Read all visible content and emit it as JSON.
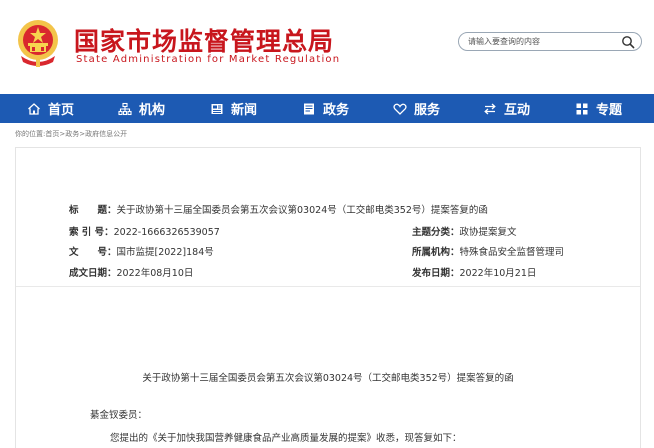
{
  "header": {
    "title_cn": "国家市场监督管理总局",
    "title_en": "State Administration for Market Regulation",
    "search_placeholder": "请输入要查询的内容",
    "colors": {
      "brand_red": "#c8161d",
      "nav_blue": "#1d5ab3",
      "emblem_gold": "#f3c44a"
    }
  },
  "nav": {
    "items": [
      {
        "label": "首页",
        "icon": "home-icon"
      },
      {
        "label": "机构",
        "icon": "org-chart-icon"
      },
      {
        "label": "新闻",
        "icon": "news-icon"
      },
      {
        "label": "政务",
        "icon": "government-affairs-icon"
      },
      {
        "label": "服务",
        "icon": "heart-icon"
      },
      {
        "label": "互动",
        "icon": "exchange-arrows-icon"
      },
      {
        "label": "专题",
        "icon": "grid-icon"
      }
    ]
  },
  "breadcrumb": {
    "prefix": "你的位置:",
    "items": [
      "首页",
      "政务",
      "政府信息公开"
    ],
    "separator": ">"
  },
  "meta": {
    "title_label": "标　　题：",
    "title_value": "关于政协第十三届全国委员会第五次会议第03024号（工交邮电类352号）提案答复的函",
    "index_label": "索 引 号：",
    "index_value": "2022-1666326539057",
    "topic_label": "主题分类：",
    "topic_value": "政协提案复文",
    "docno_label": "文　　号：",
    "docno_value": "国市监提[2022]184号",
    "org_label": "所属机构：",
    "org_value": "特殊食品安全监督管理司",
    "created_label": "成文日期：",
    "created_value": "2022年08月10日",
    "published_label": "发布日期：",
    "published_value": "2022年10月21日"
  },
  "document": {
    "title": "关于政协第十三届全国委员会第五次会议第03024号（工交邮电类352号）提案答复的函",
    "salutation": "綦金钗委员：",
    "first_paragraph": "您提出的《关于加快我国营养健康食品产业高质量发展的提案》收悉，现答复如下："
  }
}
